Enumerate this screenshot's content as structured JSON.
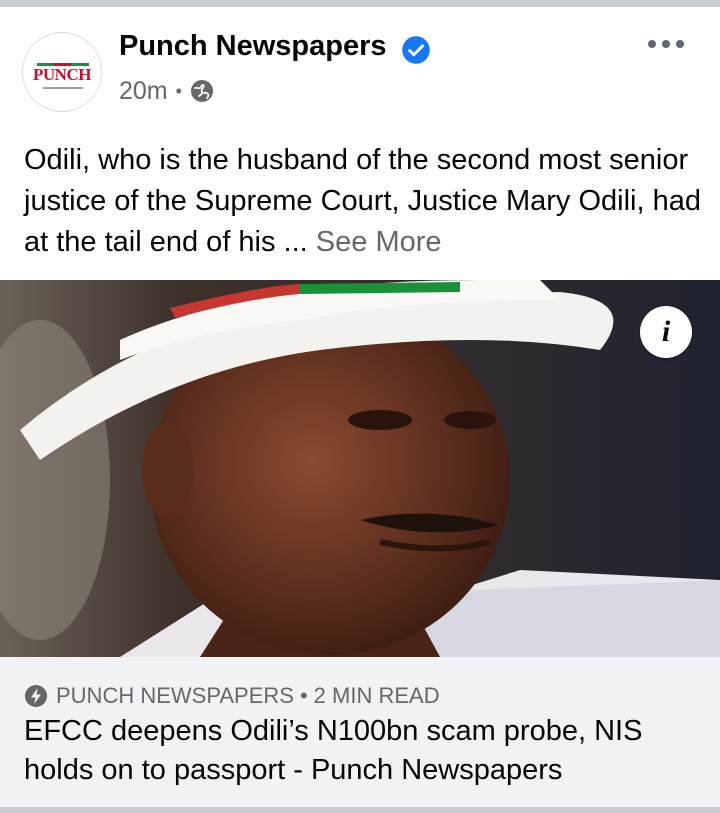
{
  "post": {
    "page_name": "Punch Newspapers",
    "timestamp": "20m",
    "separator": "•",
    "avatar_logo_text": "PUNCH",
    "text": "Odili, who is the husband of the second most senior justice of the Supreme Court, Justice Mary Odili, had at the tail end of his ...",
    "see_more": "See More"
  },
  "photo": {
    "info_label": "i"
  },
  "link_preview": {
    "source": "PUNCH NEWSPAPERS",
    "separator": "•",
    "read_time": "2 MIN READ",
    "title": "EFCC deepens Odili’s N100bn scam probe, NIS holds on to passport - Punch Newspapers"
  },
  "icons": {
    "verified": "verified-badge-icon",
    "audience": "globe-icon",
    "more": "more-options-icon",
    "instant_article": "lightning-bolt-icon",
    "info": "info-icon"
  },
  "colors": {
    "brand_blue": "#1877f2",
    "secondary_text": "#65676b",
    "preview_bg": "#f0f2f5",
    "logo_red": "#c8102e"
  }
}
